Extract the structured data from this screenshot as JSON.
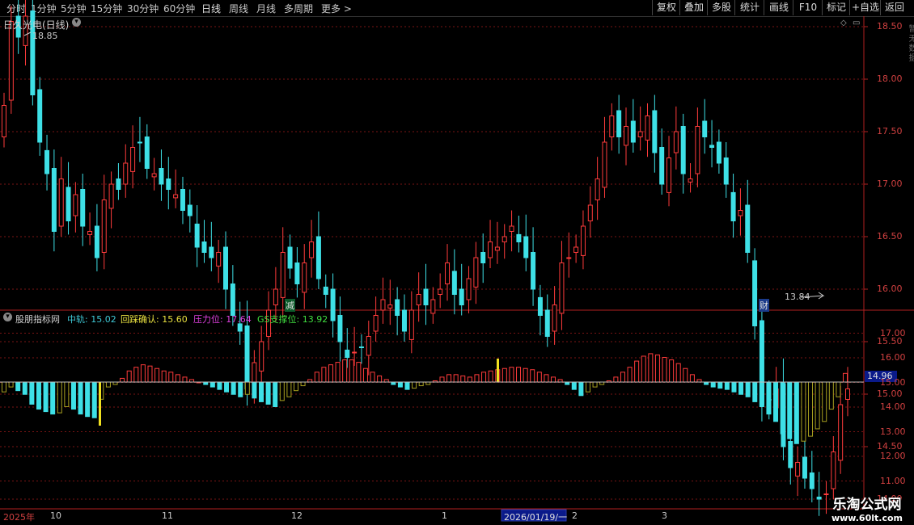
{
  "toolbar": {
    "periods": [
      "分时",
      "1分钟",
      "5分钟",
      "15分钟",
      "30分钟",
      "60分钟",
      "日线",
      "周线",
      "月线",
      "多周期",
      "更多"
    ],
    "more_arrow": ">",
    "active_period": "日线",
    "right_buttons": [
      "复权",
      "叠加",
      "多股",
      "统计",
      "画线",
      "F10",
      "标记",
      "+自选",
      "返回"
    ]
  },
  "main_panel": {
    "stock_title": "日久光电(日线)",
    "high_label": "18.85",
    "low_label": "13.84",
    "marker_jian": "减",
    "marker_cai": "财",
    "price_axis": [
      "18.50",
      "18.00",
      "17.50",
      "17.00",
      "16.50",
      "16.00",
      "15.50",
      "15.00",
      "14.50",
      "14.00"
    ],
    "right_edge_text": "暂无数据"
  },
  "indicator_panel": {
    "name": "股朋指标网",
    "items": [
      {
        "label": "中轨:",
        "value": "15.02",
        "color": "#3fc9d6"
      },
      {
        "label": "回踩确认:",
        "value": "15.60",
        "color": "#e8e040"
      },
      {
        "label": "压力位:",
        "value": "17.64",
        "color": "#e040e0"
      },
      {
        "label": "GS支撑位:",
        "value": "13.92",
        "color": "#40e040"
      }
    ],
    "axis": [
      "17.00",
      "16.00",
      "15.00",
      "14.00",
      "13.00",
      "12.00",
      "11.00"
    ],
    "current_value": "14.96"
  },
  "date_axis": {
    "labels": [
      "2025年",
      "10",
      "11",
      "12",
      "1",
      "2",
      "3"
    ],
    "highlight": "2026/01/19/一"
  },
  "watermark": {
    "line1": "乐淘公式网",
    "line2": "www.60lt.com"
  },
  "colors": {
    "up": "#ff3b3b",
    "down": "#3ee0e6",
    "olive": "#a8a020",
    "yellow": "#f0e020",
    "grid": "#7a1414"
  }
}
